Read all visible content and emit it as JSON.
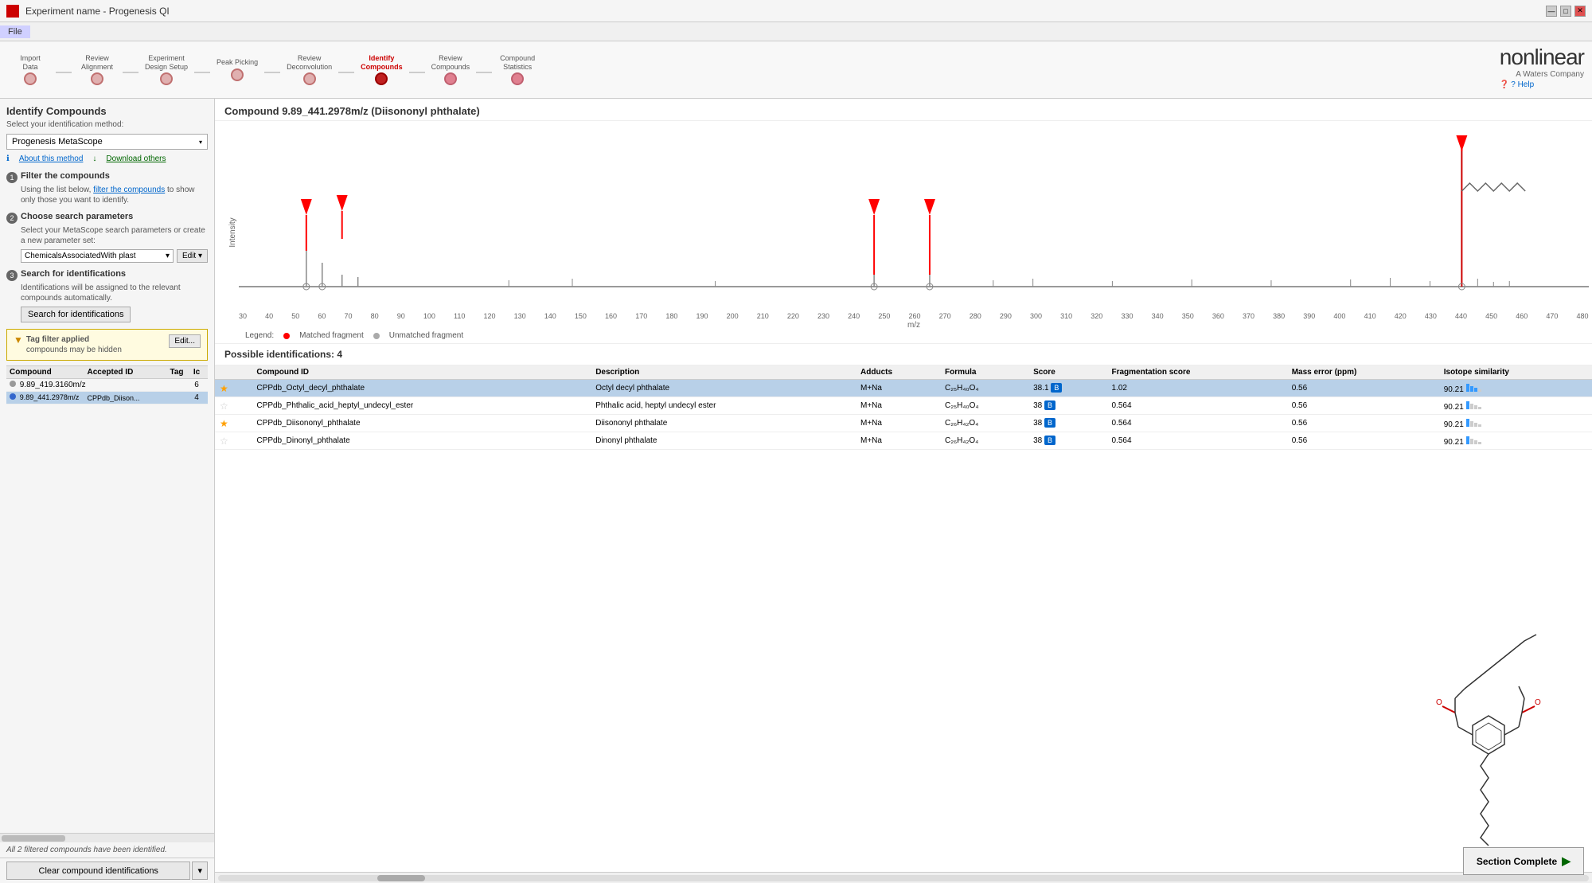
{
  "window": {
    "title": "Experiment name - Progenesis QI",
    "min_btn": "—",
    "max_btn": "□",
    "close_btn": "✕"
  },
  "menu": {
    "items": [
      "File"
    ]
  },
  "workflow": {
    "steps": [
      {
        "label": "Import\nData",
        "dot_class": "dot-gray"
      },
      {
        "label": "Review\nAlignment",
        "dot_class": "dot-gray"
      },
      {
        "label": "Experiment\nDesign Setup",
        "dot_class": "dot-gray"
      },
      {
        "label": "Peak Picking",
        "dot_class": "dot-gray"
      },
      {
        "label": "Review\nDeconvolution",
        "dot_class": "dot-gray"
      },
      {
        "label": "Identify\nCompounds",
        "dot_class": "dot-active"
      },
      {
        "label": "Review\nCompounds",
        "dot_class": "dot-pink"
      },
      {
        "label": "Compound\nStatistics",
        "dot_class": "dot-pink"
      }
    ],
    "logo": {
      "brand": "nonlinear",
      "sub": "A Waters Company"
    },
    "help": "? Help"
  },
  "left_panel": {
    "title": "Identify Compounds",
    "subtitle": "Select your identification method:",
    "method_dropdown": "Progenesis MetaScope",
    "about_method": "About this method",
    "download_others": "Download others",
    "steps": [
      {
        "num": "1",
        "title": "Filter the compounds",
        "desc_before": "Using the list below, ",
        "desc_link": "filter the compounds",
        "desc_after": " to show only those you want to identify."
      },
      {
        "num": "2",
        "title": "Choose search parameters",
        "desc": "Select your MetaScope search parameters or create a new parameter set:",
        "param_value": "ChemicalsAssociatedWith plast",
        "edit_label": "Edit ▾"
      },
      {
        "num": "3",
        "title": "Search for identifications",
        "desc": "Identifications will be assigned to the relevant compounds automatically.",
        "search_btn": "Search for identifications"
      }
    ],
    "tag_filter": {
      "text": "Tag filter applied\ncompounds may be hidden",
      "edit_btn": "Edit..."
    },
    "compound_list": {
      "headers": [
        "Compound",
        "Accepted ID",
        "Tag",
        "Ic"
      ],
      "rows": [
        {
          "name": "9.89_419.3160m/z",
          "accepted_id": "",
          "tag": "",
          "ic": "6",
          "dot": "gray",
          "selected": false
        },
        {
          "name": "9.89_441.2978m/z",
          "accepted_id": "CPPdb_Diison...",
          "tag": "",
          "ic": "4",
          "dot": "blue",
          "selected": true
        }
      ]
    },
    "status": "All 2 filtered compounds have been identified.",
    "clear_btn": "Clear compound identifications"
  },
  "right_panel": {
    "compound_title": "Compound 9.89_441.2978m/z (Diisononyl phthalate)",
    "chart": {
      "y_label": "Intensity",
      "x_label": "m/z",
      "x_ticks": [
        "30",
        "40",
        "50",
        "60",
        "70",
        "80",
        "90",
        "100",
        "110",
        "120",
        "130",
        "140",
        "150",
        "160",
        "170",
        "180",
        "190",
        "200",
        "210",
        "220",
        "230",
        "240",
        "250",
        "260",
        "270",
        "280",
        "290",
        "300",
        "310",
        "320",
        "330",
        "340",
        "350",
        "360",
        "370",
        "380",
        "390",
        "400",
        "410",
        "420",
        "430",
        "440",
        "450",
        "460",
        "470",
        "480"
      ],
      "legend_matched": "Matched fragment",
      "legend_unmatched": "Unmatched fragment"
    },
    "possible_identifications": {
      "title": "Possible identifications: 4",
      "headers": [
        "",
        "Compound ID",
        "Description",
        "Adducts",
        "Formula",
        "Score",
        "Fragmentation score",
        "Mass error (ppm)",
        "Isotope similarity"
      ],
      "rows": [
        {
          "star": "★",
          "compound_id": "CPPdb_Octyl_decyl_phthalate",
          "description": "Octyl decyl phthalate",
          "adducts": "M+Na",
          "formula": "C₂₅H₄₀O₄",
          "score": "38.1",
          "score_badge": "B",
          "frag_score": "1.02",
          "mass_error": "0.56",
          "iso_similarity": "90.21",
          "selected": true
        },
        {
          "star": "☆",
          "compound_id": "CPPdb_Phthalic_acid_heptyl_undecyl_ester",
          "description": "Phthalic acid, heptyl undecyl ester",
          "adducts": "M+Na",
          "formula": "C₂₅H₄₀O₄",
          "score": "38",
          "score_badge": "B",
          "frag_score": "0.564",
          "mass_error": "0.56",
          "iso_similarity": "90.21",
          "selected": false
        },
        {
          "star": "★",
          "compound_id": "CPPdb_Diisononyl_phthalate",
          "description": "Diisononyl phthalate",
          "adducts": "M+Na",
          "formula": "C₂₆H₄₂O₄",
          "score": "38",
          "score_badge": "B",
          "frag_score": "0.564",
          "mass_error": "0.56",
          "iso_similarity": "90.21",
          "selected": false
        },
        {
          "star": "☆",
          "compound_id": "CPPdb_Dinonyl_phthalate",
          "description": "Dinonyl phthalate",
          "adducts": "M+Na",
          "formula": "C₂₆H₄₂O₄",
          "score": "38",
          "score_badge": "B",
          "frag_score": "0.564",
          "mass_error": "0.56",
          "iso_similarity": "90.21",
          "selected": false
        }
      ]
    }
  },
  "footer": {
    "section_complete": "Section Complete"
  }
}
